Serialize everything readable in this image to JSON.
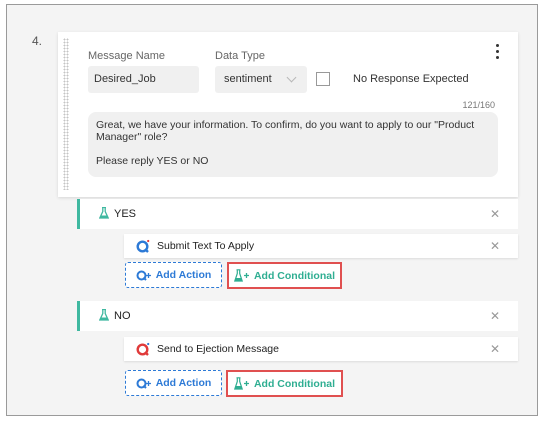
{
  "step": {
    "number": "4."
  },
  "message": {
    "name_label": "Message Name",
    "name_value": "Desired_Job",
    "type_label": "Data Type",
    "type_value": "sentiment",
    "no_response_label": "No Response Expected",
    "no_response_checked": false,
    "char_count": "121/160",
    "text_line1": "Great, we have your information. To confirm, do you want to apply to our \"Product Manager\" role?",
    "text_line2": "Please reply YES or NO"
  },
  "conditions": [
    {
      "label": "YES",
      "action": {
        "label": "Submit Text To Apply",
        "icon": "action-logo-blue"
      },
      "add_action_label": "Add Action",
      "add_conditional_label": "Add Conditional"
    },
    {
      "label": "NO",
      "action": {
        "label": "Send to Ejection Message",
        "icon": "action-logo-red"
      },
      "add_action_label": "Add Action",
      "add_conditional_label": "Add Conditional"
    }
  ],
  "colors": {
    "accent_teal": "#3fb8a0",
    "action_blue": "#2d7ad6",
    "highlight_red": "#e05050",
    "ejection_red": "#e03b3b"
  },
  "icons": {
    "close": "close-icon",
    "menu": "kebab-menu-icon",
    "condition": "flask-icon"
  }
}
